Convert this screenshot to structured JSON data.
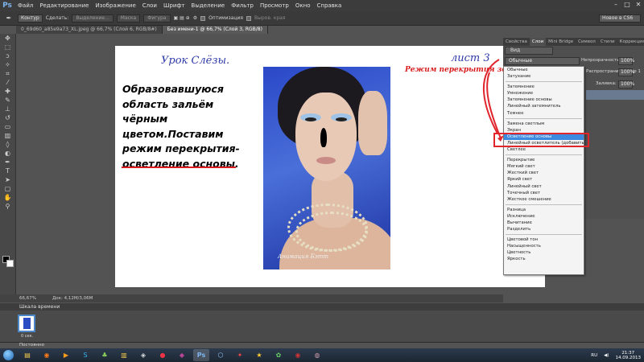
{
  "menubar": {
    "logo": "Ps",
    "items": [
      "Файл",
      "Редактирование",
      "Изображение",
      "Слои",
      "Шрифт",
      "Выделение",
      "Фильтр",
      "Просмотр",
      "Окно",
      "Справка"
    ]
  },
  "options_bar": {
    "path_mode": "Контур",
    "make_label": "Сделать:",
    "selection_btn": "Выделение...",
    "mask_btn": "Маска",
    "shape_btn": "Фигура",
    "optimize_label": "Оптимизация",
    "align_edges_label": "Выров. края",
    "workspace": "Новое в CS6"
  },
  "tabs": [
    {
      "label": "0_69d60_a85e9a73_XL.jpeg @ 66,7% (Слой 6, RGB/8#)",
      "active": false
    },
    {
      "label": "Без имени-1 @ 66,7% (Слой 3, RGB/8)",
      "active": true
    }
  ],
  "document": {
    "title": "Урок Слёзы.",
    "sheet": "лист 3",
    "mode_here": "Режим перекрытия здесь!",
    "lesson_lines": [
      "Образовавшуюся",
      "область зальём",
      "чёрным",
      "цветом.Поставим",
      "режим перекрытия-",
      "осветление основы."
    ],
    "watermark": "Анимация Бэтт"
  },
  "right_panel": {
    "tabs": [
      "Свойства",
      "Слои",
      "Mini Bridge",
      "Символ",
      "Стили",
      "Коррекция"
    ],
    "active_tab": "Слои",
    "kind": "Вид",
    "blend_mode": "Обычные",
    "opacity_label": "Непрозрачность:",
    "opacity_value": "100%",
    "spread_label": "Распространить кадр 1",
    "spread_value": "100%",
    "fill_label": "Заливка:",
    "fill_value": "100%"
  },
  "blend_menu": {
    "groups": [
      [
        "Обычные",
        "Затухание"
      ],
      [
        "Затемнение",
        "Умножение",
        "Затемнение основы",
        "Линейный затемнитель",
        "Темнее"
      ],
      [
        "Замена светлым",
        "Экран",
        "Осветление основы",
        "Линейный осветлитель (добавить)",
        "Светлее"
      ],
      [
        "Перекрытие",
        "Мягкий свет",
        "Жесткий свет",
        "Яркий свет",
        "Линейный свет",
        "Точечный свет",
        "Жесткое смешение"
      ],
      [
        "Разница",
        "Исключение",
        "Вычитание",
        "Разделить"
      ],
      [
        "Цветовой тон",
        "Насыщенность",
        "Цветность",
        "Яркость"
      ]
    ],
    "highlighted": "Осветление основы"
  },
  "status": {
    "zoom": "66,67%",
    "doc": "Док: 4,12M/3,06M"
  },
  "timeline": {
    "title": "Шкала времени",
    "frame_label": "0 сек.",
    "loop": "Постоянно"
  },
  "taskbar": {
    "lang": "RU",
    "time": "21:37",
    "date": "14.09.2013"
  },
  "colors": {
    "accent_red": "#e0252d",
    "title_blue": "#2d3aa8",
    "menu_highlight": "#3b8ae0"
  }
}
